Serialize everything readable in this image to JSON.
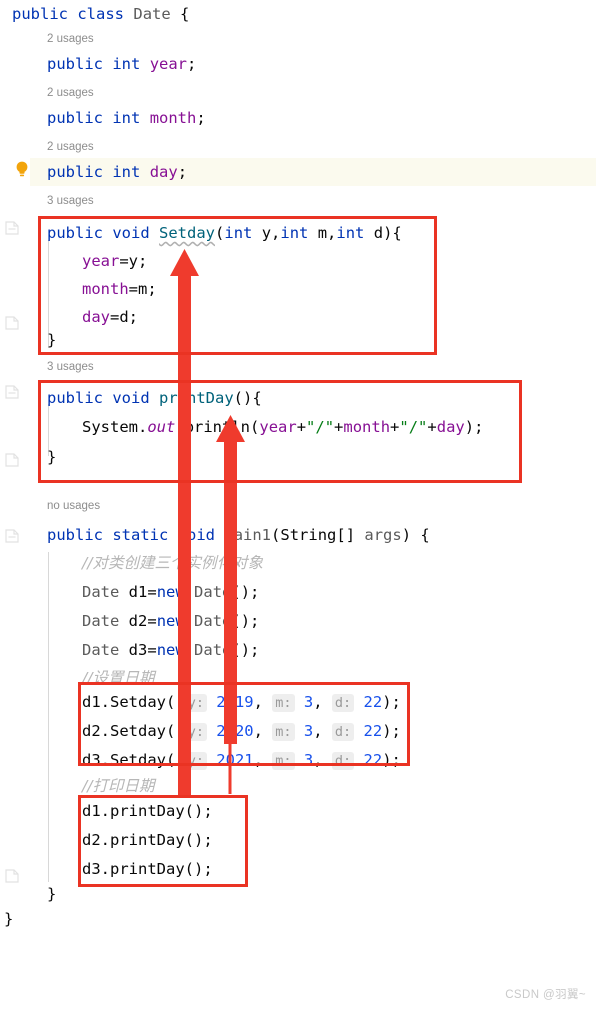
{
  "watermark": "CSDN @羽翼~",
  "colors": {
    "annotation_red": "#ea3323",
    "keyword": "#0033b3",
    "field": "#871094",
    "method": "#00627a",
    "string": "#067d17",
    "number": "#1750eb",
    "comment": "#b7b7b7",
    "usage_hint": "#8d8d8d",
    "highlight_row": "#fbfaee",
    "bulb": "#f2a40c"
  },
  "usage_labels": {
    "year": "2 usages",
    "month": "2 usages",
    "day": "2 usages",
    "setday": "3 usages",
    "printday": "3 usages",
    "main1": "no usages"
  },
  "code": {
    "l01": "public class Date {",
    "l02": "public int year;",
    "l03": "public int month;",
    "l04": "public int day;",
    "l05": "public void Setday(int y,int m,int d){",
    "l06": "year=y;",
    "l07": "month=m;",
    "l08": "day=d;",
    "l09": "}",
    "l10": "public void printDay(){",
    "l11": "System.out.println(year+\"/\"+month+\"/\"+day);",
    "l12": "}",
    "l13": "public static void main1(String[] args) {",
    "l14": "//对类创建三个实例化对象",
    "l15": "Date d1=new Date();",
    "l16": "Date d2=new Date();",
    "l17": "Date d3=new Date();",
    "l18": "//设置日期",
    "l19": "d1.Setday( y: 2019, m: 3, d: 22);",
    "l20": "d2.Setday( y: 2020, m: 3, d: 22);",
    "l21": "d3.Setday( y: 2021, m: 3, d: 22);",
    "l22": "//打印日期",
    "l23": "d1.printDay();",
    "l24": "d2.printDay();",
    "l25": "d3.printDay();",
    "l26": "}",
    "l27": "}"
  },
  "tokens": {
    "public": "public",
    "class": "class",
    "static": "static",
    "void": "void",
    "int": "int",
    "new": "new",
    "Date": "Date",
    "String": "String[]",
    "args": "args",
    "year": "year",
    "month": "month",
    "day": "day",
    "Setday": "Setday",
    "printDay": "printDay",
    "main1": "main1",
    "System": "System",
    "out": "out",
    "println": "println",
    "slash_str": "\"/\"",
    "open_brace": "{",
    "close_brace": "}",
    "semicolon": ";"
  },
  "param_hints": {
    "y": "y:",
    "m": "m:",
    "d": "d:"
  },
  "values": {
    "years": [
      "2019",
      "2020",
      "2021"
    ],
    "month": "3",
    "day": "22",
    "objects": [
      "d1",
      "d2",
      "d3"
    ]
  },
  "comments": {
    "create": "//对类创建三个实例化对象",
    "setdate": "//设置日期",
    "printdate": "//打印日期"
  },
  "annotations": {
    "box_setday_method": "Setday method definition",
    "box_printday_method": "printDay method definition",
    "box_setday_calls": "Setday invocation block",
    "box_printday_calls": "printDay invocation block",
    "arrow_setday": "arrow from Setday calls to Setday definition",
    "arrow_printday": "arrow from printDay calls to printDay definition"
  }
}
